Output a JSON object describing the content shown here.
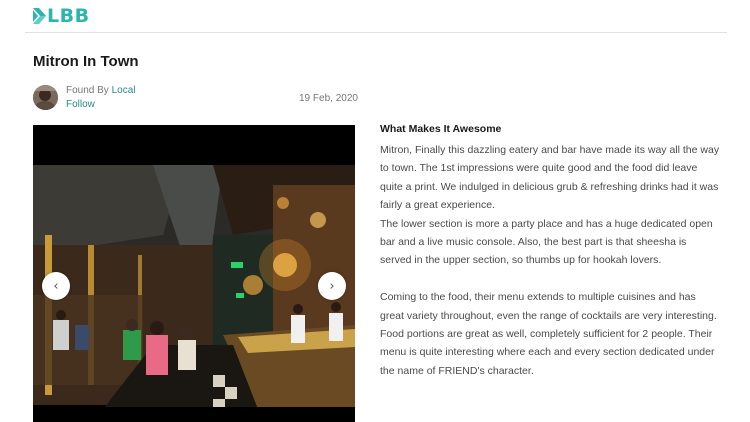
{
  "header": {
    "logo_text": "LBB"
  },
  "article": {
    "title": "Mitron In Town",
    "author_prefix": "Found By",
    "author": "Local",
    "follow": "Follow",
    "date": "19 Feb, 2020"
  },
  "gallery": {
    "prev_icon": "chevron-left-icon",
    "next_icon": "chevron-right-icon"
  },
  "content": {
    "heading": "What Makes It Awesome",
    "paragraphs": [
      "Mitron, Finally this dazzling eatery and bar have made its way all the way to town. The 1st impressions were quite good and the food did leave quite a print. We indulged in delicious grub & refreshing drinks had it was fairly a great experience.",
      "The lower section is more a party place and has a huge dedicated open bar and a live music console. Also, the best part is that sheesha is served in the upper section, so thumbs up for hookah lovers.",
      "Coming to the food, their menu extends to multiple cuisines and has great variety throughout, even the range of cocktails are very interesting. Food portions are great as well, completely sufficient for 2 people. Their menu is quite interesting where each and every section dedicated under the name of FRIEND's character."
    ]
  },
  "colors": {
    "accent": "#2cb5ad",
    "link": "#2a8a8a"
  }
}
